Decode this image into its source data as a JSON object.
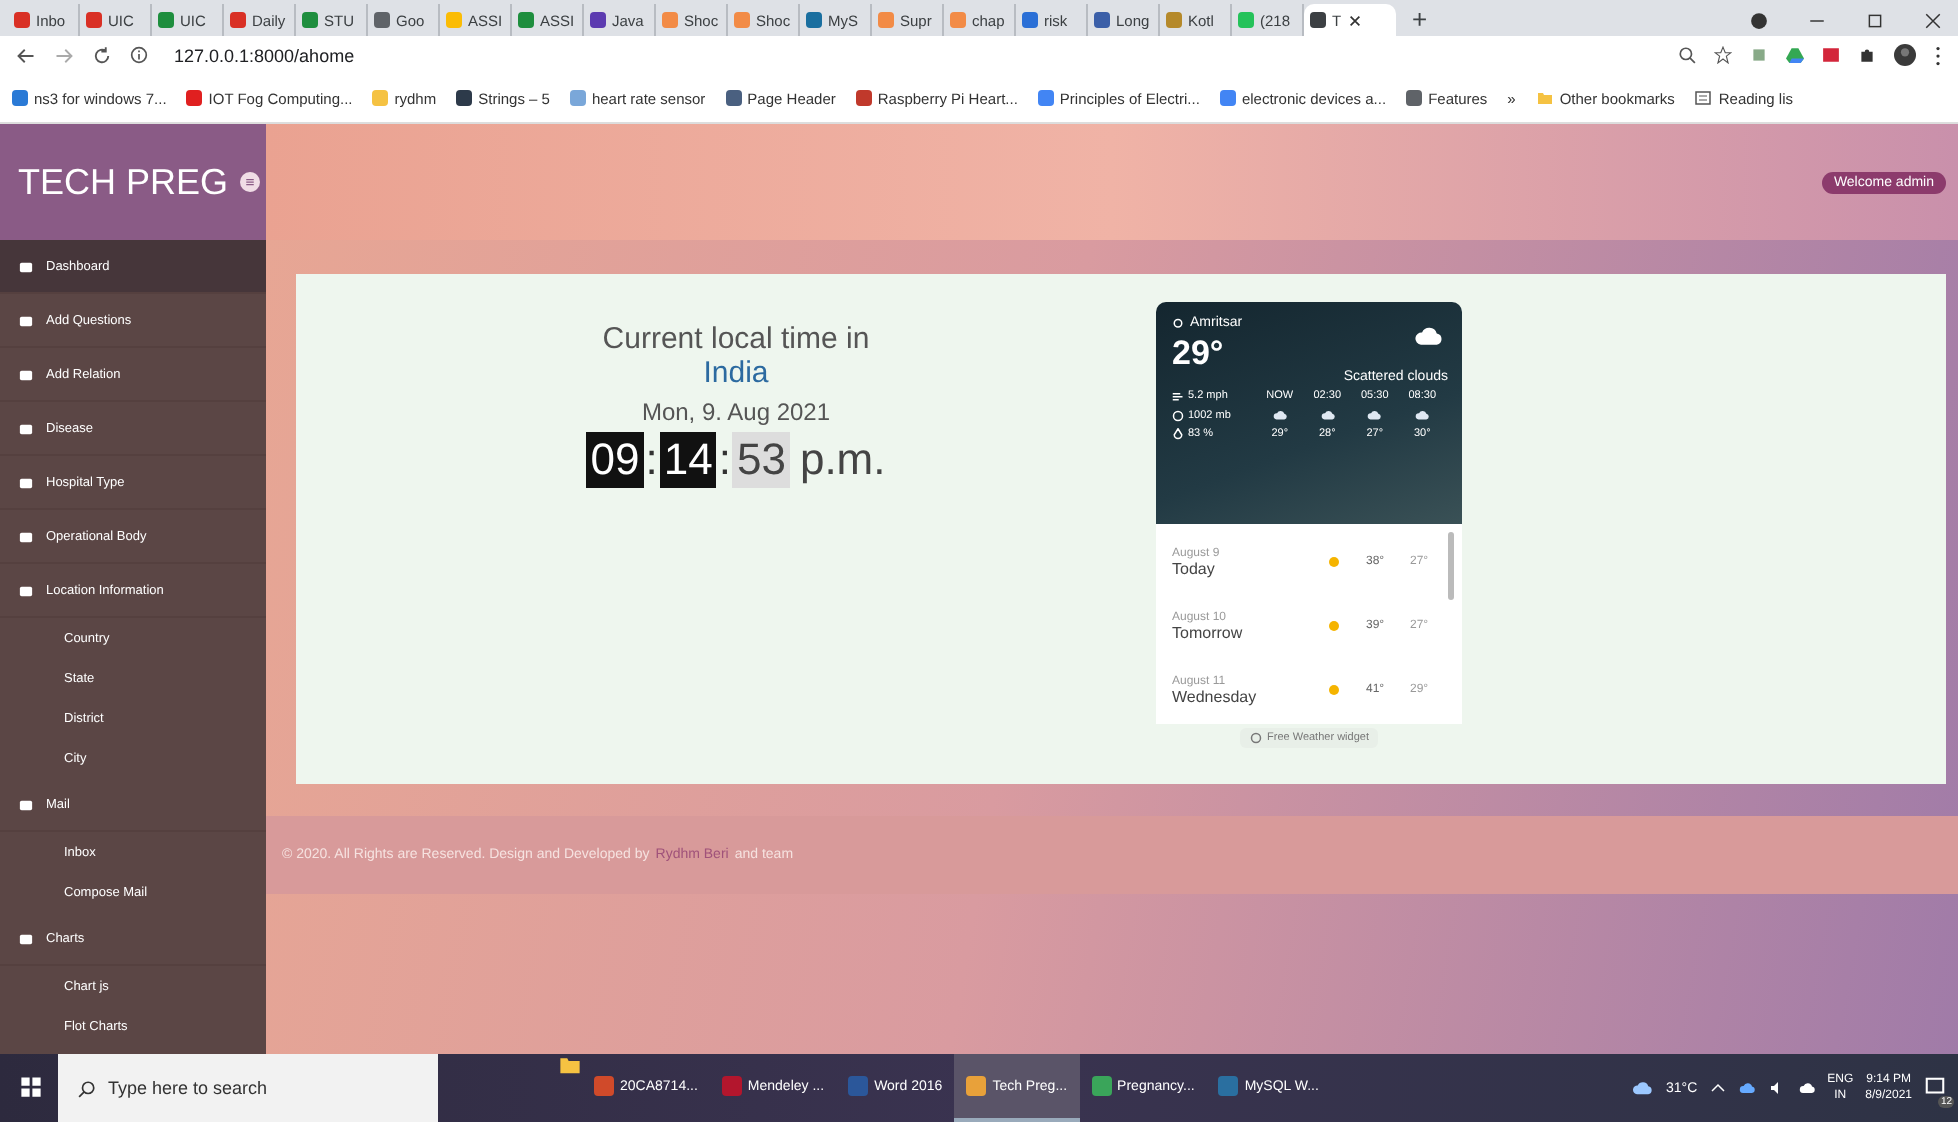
{
  "browser": {
    "tabs": [
      {
        "title": "Inbo",
        "color": "#d93025",
        "selected": false
      },
      {
        "title": "UIC",
        "color": "#d93025",
        "selected": false
      },
      {
        "title": "UIC",
        "color": "#1e8e3e",
        "selected": false
      },
      {
        "title": "Daily",
        "color": "#d93025",
        "selected": false
      },
      {
        "title": "STU",
        "color": "#1e8e3e",
        "selected": false
      },
      {
        "title": "Goo",
        "color": "#5f6368",
        "selected": false
      },
      {
        "title": "ASSI",
        "color": "#fbbc04",
        "selected": false
      },
      {
        "title": "ASSI",
        "color": "#1e8e3e",
        "selected": false
      },
      {
        "title": "Java",
        "color": "#5c3bb0",
        "selected": false
      },
      {
        "title": "Shoc",
        "color": "#f28b46",
        "selected": false
      },
      {
        "title": "Shoc",
        "color": "#f28b46",
        "selected": false
      },
      {
        "title": "MyS",
        "color": "#1a6fa0",
        "selected": false
      },
      {
        "title": "Supr",
        "color": "#f28b46",
        "selected": false
      },
      {
        "title": "chap",
        "color": "#f28b46",
        "selected": false
      },
      {
        "title": "risk",
        "color": "#2a6fd6",
        "selected": false
      },
      {
        "title": "Long",
        "color": "#3b5fa8",
        "selected": false
      },
      {
        "title": "Kotl",
        "color": "#b5892a",
        "selected": false
      },
      {
        "title": "(218",
        "color": "#25c25a",
        "selected": false
      },
      {
        "title": "T",
        "color": "#3c4043",
        "selected": true
      }
    ],
    "new_tab": "+",
    "address": "127.0.0.1:8000/ahome",
    "bookmarks": [
      {
        "label": "ns3 for windows 7...",
        "color": "#2a7ad6"
      },
      {
        "label": "IOT Fog Computing...",
        "color": "#e02020"
      },
      {
        "label": "rydhm",
        "color": "#f5c242"
      },
      {
        "label": "Strings – 5",
        "color": "#2d3a4a"
      },
      {
        "label": "heart rate sensor",
        "color": "#7aa7d9"
      },
      {
        "label": "Page Header",
        "color": "#4a6080"
      },
      {
        "label": "Raspberry Pi Heart...",
        "color": "#c0392b"
      },
      {
        "label": "Principles of Electri...",
        "color": "#4285f4"
      },
      {
        "label": "electronic devices a...",
        "color": "#4285f4"
      },
      {
        "label": "Features",
        "color": "#5f6368"
      }
    ],
    "bookmarks_overflow": "»",
    "other_bookmarks": "Other bookmarks",
    "reading_list": "Reading lis"
  },
  "app": {
    "logo": "TECH PREG",
    "welcome": "Welcome admin",
    "sidebar": [
      {
        "label": "Dashboard",
        "selected": true
      },
      {
        "label": "Add Questions",
        "selected": false
      },
      {
        "label": "Add Relation",
        "selected": false
      },
      {
        "label": "Disease",
        "selected": false
      },
      {
        "label": "Hospital Type",
        "selected": false
      },
      {
        "label": "Operational Body",
        "selected": false
      },
      {
        "label": "Location Information",
        "selected": false,
        "children": [
          {
            "label": "Country",
            "selected": false
          },
          {
            "label": "State",
            "selected": false
          },
          {
            "label": "District",
            "selected": false
          },
          {
            "label": "City",
            "selected": false
          }
        ]
      },
      {
        "label": "Mail",
        "selected": false,
        "children": [
          {
            "label": "Inbox",
            "selected": false
          },
          {
            "label": "Compose Mail",
            "selected": false
          }
        ]
      },
      {
        "label": "Charts",
        "selected": false,
        "children": [
          {
            "label": "Chart js",
            "selected": false
          },
          {
            "label": "Flot Charts",
            "selected": false
          }
        ]
      }
    ],
    "clock": {
      "heading": "Current local time in",
      "country": "India",
      "date": "Mon, 9. Aug 2021",
      "parts": [
        {
          "text": "09",
          "kind": "dark"
        },
        {
          "text": ":",
          "kind": "sep"
        },
        {
          "text": "14",
          "kind": "dark"
        },
        {
          "text": ":",
          "kind": "sep"
        },
        {
          "text": "53",
          "kind": "light"
        },
        {
          "text": "p.m.",
          "kind": "plain"
        }
      ]
    },
    "weather": {
      "location": "Amritsar",
      "temperature": "29°",
      "condition": "Scattered clouds",
      "stats": [
        "5.2 mph",
        "1002 mb",
        "83 %"
      ],
      "hours": [
        {
          "time": "NOW",
          "temp": "29°"
        },
        {
          "time": "02:30",
          "temp": "28°"
        },
        {
          "time": "05:30",
          "temp": "27°"
        },
        {
          "time": "08:30",
          "temp": "30°"
        }
      ],
      "days": [
        {
          "date": "August 9",
          "day": "Today",
          "high": "38°",
          "low": "27°"
        },
        {
          "date": "August 10",
          "day": "Tomorrow",
          "high": "39°",
          "low": "27°"
        },
        {
          "date": "August 11",
          "day": "Wednesday",
          "high": "41°",
          "low": "29°"
        }
      ],
      "credit": "Free Weather widget"
    },
    "footer": {
      "text": "© 2020. All Rights are Reserved. Design and Developed by",
      "author": "Rydhm Beri",
      "suffix": "and team"
    }
  },
  "taskbar": {
    "search": "Type here to search",
    "apps": [
      {
        "label": "20CA8714...",
        "color": "#d04a2a",
        "selected": false
      },
      {
        "label": "Mendeley ...",
        "color": "#b3162d",
        "selected": false
      },
      {
        "label": "Word 2016",
        "color": "#2b579a",
        "selected": false
      },
      {
        "label": "Tech Preg...",
        "color": "#e8a13a",
        "selected": true
      },
      {
        "label": "Pregnancy...",
        "color": "#3aa55a",
        "selected": false
      },
      {
        "label": "MySQL W...",
        "color": "#2a6fa0",
        "selected": false
      }
    ],
    "weather": "31°C",
    "language": "ENG",
    "region": "IN",
    "time": "9:14 PM",
    "date": "8/9/2021",
    "notifications": "12"
  }
}
